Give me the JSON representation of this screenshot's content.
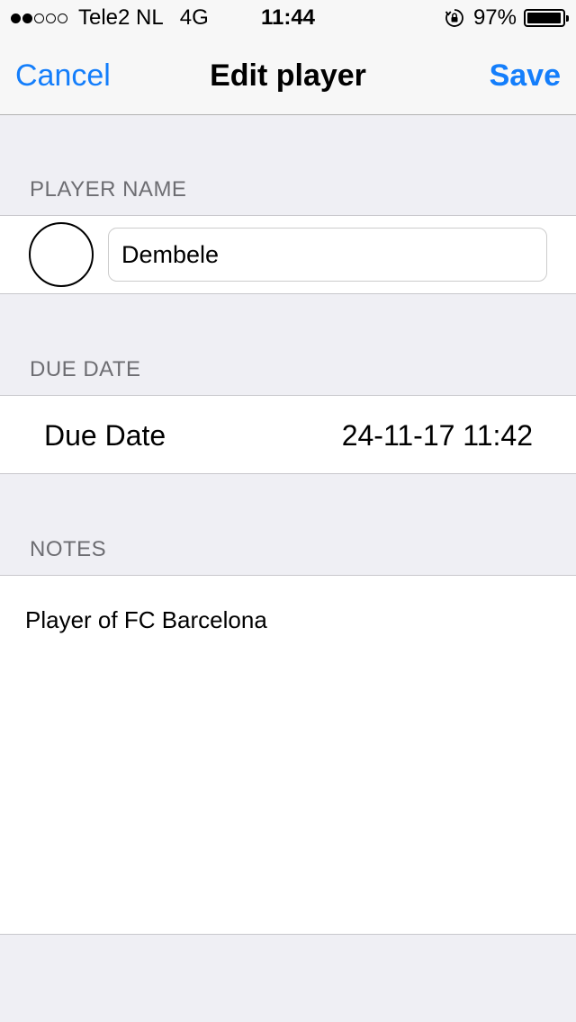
{
  "status_bar": {
    "signal_filled": 2,
    "signal_total": 5,
    "carrier": "Tele2 NL",
    "network": "4G",
    "time": "11:44",
    "battery_percent": "97%",
    "battery_level": 0.97
  },
  "nav": {
    "cancel_label": "Cancel",
    "title": "Edit player",
    "save_label": "Save",
    "accent_color": "#147efb"
  },
  "sections": {
    "player_name": {
      "header": "PLAYER NAME",
      "name_value": "Dembele"
    },
    "due_date": {
      "header": "DUE DATE",
      "label": "Due Date",
      "value": "24-11-17 11:42"
    },
    "notes": {
      "header": "NOTES",
      "value": "Player of FC Barcelona"
    }
  }
}
